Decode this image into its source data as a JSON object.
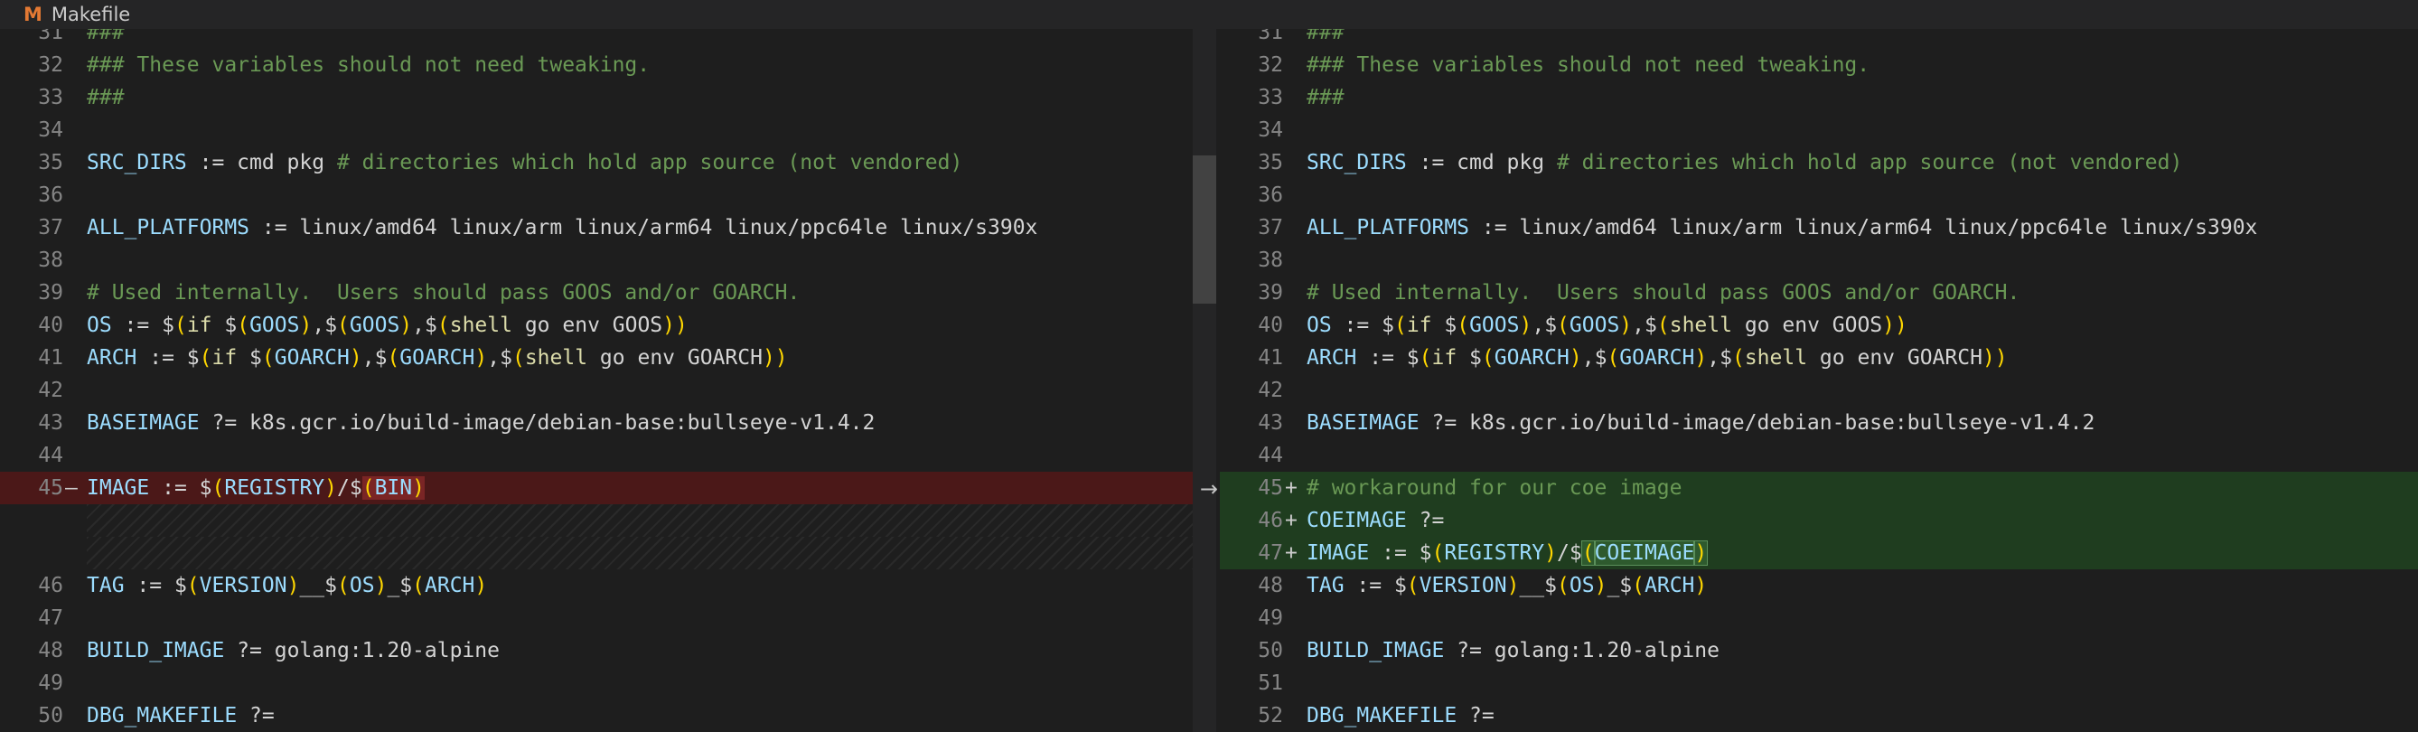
{
  "tab": {
    "icon": "makefile-icon",
    "icon_glyph": "M",
    "filename": "Makefile"
  },
  "colors": {
    "removed_bg": "#4b1818",
    "added_bg": "#1f3d1f",
    "comment": "#6a9955",
    "variable": "#9cdcfe",
    "function": "#dcdcaa",
    "bracket": "#ffd700"
  },
  "diff_arrow": "→",
  "left": [
    {
      "n": "31",
      "m": "",
      "type": "ctx",
      "t": [
        [
          "c-comment",
          "###"
        ]
      ]
    },
    {
      "n": "32",
      "m": "",
      "type": "ctx",
      "t": [
        [
          "c-comment",
          "### These variables should not need tweaking."
        ]
      ]
    },
    {
      "n": "33",
      "m": "",
      "type": "ctx",
      "t": [
        [
          "c-comment",
          "###"
        ]
      ]
    },
    {
      "n": "34",
      "m": "",
      "type": "ctx",
      "t": []
    },
    {
      "n": "35",
      "m": "",
      "type": "ctx",
      "t": [
        [
          "c-var",
          "SRC_DIRS"
        ],
        [
          "c-op",
          " := cmd pkg "
        ],
        [
          "c-comment",
          "# directories which hold app source (not vendored)"
        ]
      ]
    },
    {
      "n": "36",
      "m": "",
      "type": "ctx",
      "t": []
    },
    {
      "n": "37",
      "m": "",
      "type": "ctx",
      "t": [
        [
          "c-var",
          "ALL_PLATFORMS"
        ],
        [
          "c-op",
          " := linux/amd64 linux/arm linux/arm64 linux/ppc64le linux/s390x"
        ]
      ]
    },
    {
      "n": "38",
      "m": "",
      "type": "ctx",
      "t": []
    },
    {
      "n": "39",
      "m": "",
      "type": "ctx",
      "t": [
        [
          "c-comment",
          "# Used internally.  Users should pass GOOS and/or GOARCH."
        ]
      ]
    },
    {
      "n": "40",
      "m": "",
      "type": "ctx",
      "t": [
        [
          "c-var",
          "OS"
        ],
        [
          "c-op",
          " := "
        ],
        [
          "c-dollar",
          "$"
        ],
        [
          "c-paren",
          "("
        ],
        [
          "c-fn",
          "if "
        ],
        [
          "c-dollar",
          "$"
        ],
        [
          "c-paren",
          "("
        ],
        [
          "c-var",
          "GOOS"
        ],
        [
          "c-paren",
          ")"
        ],
        [
          "c-op",
          ","
        ],
        [
          "c-dollar",
          "$"
        ],
        [
          "c-paren",
          "("
        ],
        [
          "c-var",
          "GOOS"
        ],
        [
          "c-paren",
          ")"
        ],
        [
          "c-op",
          ","
        ],
        [
          "c-dollar",
          "$"
        ],
        [
          "c-paren",
          "("
        ],
        [
          "c-fn",
          "shell"
        ],
        [
          "c-text",
          " go env GOOS"
        ],
        [
          "c-paren",
          "))"
        ]
      ]
    },
    {
      "n": "41",
      "m": "",
      "type": "ctx",
      "t": [
        [
          "c-var",
          "ARCH"
        ],
        [
          "c-op",
          " := "
        ],
        [
          "c-dollar",
          "$"
        ],
        [
          "c-paren",
          "("
        ],
        [
          "c-fn",
          "if "
        ],
        [
          "c-dollar",
          "$"
        ],
        [
          "c-paren",
          "("
        ],
        [
          "c-var",
          "GOARCH"
        ],
        [
          "c-paren",
          ")"
        ],
        [
          "c-op",
          ","
        ],
        [
          "c-dollar",
          "$"
        ],
        [
          "c-paren",
          "("
        ],
        [
          "c-var",
          "GOARCH"
        ],
        [
          "c-paren",
          ")"
        ],
        [
          "c-op",
          ","
        ],
        [
          "c-dollar",
          "$"
        ],
        [
          "c-paren",
          "("
        ],
        [
          "c-fn",
          "shell"
        ],
        [
          "c-text",
          " go env GOARCH"
        ],
        [
          "c-paren",
          "))"
        ]
      ]
    },
    {
      "n": "42",
      "m": "",
      "type": "ctx",
      "t": []
    },
    {
      "n": "43",
      "m": "",
      "type": "ctx",
      "t": [
        [
          "c-var",
          "BASEIMAGE"
        ],
        [
          "c-op",
          " ?= k8s.gcr.io/build-image/debian-base:bullseye-v1.4.2"
        ]
      ]
    },
    {
      "n": "44",
      "m": "",
      "type": "ctx",
      "t": []
    },
    {
      "n": "45",
      "m": "—",
      "type": "removed",
      "t": [
        [
          "c-var",
          "IMAGE"
        ],
        [
          "c-op",
          " := "
        ],
        [
          "c-dollar",
          "$"
        ],
        [
          "c-paren",
          "("
        ],
        [
          "c-var",
          "REGISTRY"
        ],
        [
          "c-paren",
          ")"
        ],
        [
          "c-op",
          "/"
        ],
        [
          "c-dollar",
          "$"
        ],
        [
          "c-paren hl-removed",
          "("
        ],
        [
          "c-var hl-removed",
          "BIN"
        ],
        [
          "c-paren hl-removed",
          ")"
        ]
      ]
    },
    {
      "n": "",
      "m": "",
      "type": "filler",
      "t": []
    },
    {
      "n": "",
      "m": "",
      "type": "filler",
      "t": []
    },
    {
      "n": "46",
      "m": "",
      "type": "ctx",
      "t": [
        [
          "c-var",
          "TAG"
        ],
        [
          "c-op",
          " := "
        ],
        [
          "c-dollar",
          "$"
        ],
        [
          "c-paren",
          "("
        ],
        [
          "c-var",
          "VERSION"
        ],
        [
          "c-paren",
          ")"
        ],
        [
          "c-op",
          "__"
        ],
        [
          "c-dollar",
          "$"
        ],
        [
          "c-paren",
          "("
        ],
        [
          "c-var",
          "OS"
        ],
        [
          "c-paren",
          ")"
        ],
        [
          "c-op",
          "_"
        ],
        [
          "c-dollar",
          "$"
        ],
        [
          "c-paren",
          "("
        ],
        [
          "c-var",
          "ARCH"
        ],
        [
          "c-paren",
          ")"
        ]
      ]
    },
    {
      "n": "47",
      "m": "",
      "type": "ctx",
      "t": []
    },
    {
      "n": "48",
      "m": "",
      "type": "ctx",
      "t": [
        [
          "c-var",
          "BUILD_IMAGE"
        ],
        [
          "c-op",
          " ?= golang:1.20-alpine"
        ]
      ]
    },
    {
      "n": "49",
      "m": "",
      "type": "ctx",
      "t": []
    },
    {
      "n": "50",
      "m": "",
      "type": "ctx",
      "t": [
        [
          "c-var",
          "DBG_MAKEFILE"
        ],
        [
          "c-op",
          " ?="
        ]
      ]
    }
  ],
  "right": [
    {
      "n": "31",
      "m": "",
      "type": "ctx",
      "t": [
        [
          "c-comment",
          "###"
        ]
      ]
    },
    {
      "n": "32",
      "m": "",
      "type": "ctx",
      "t": [
        [
          "c-comment",
          "### These variables should not need tweaking."
        ]
      ]
    },
    {
      "n": "33",
      "m": "",
      "type": "ctx",
      "t": [
        [
          "c-comment",
          "###"
        ]
      ]
    },
    {
      "n": "34",
      "m": "",
      "type": "ctx",
      "t": []
    },
    {
      "n": "35",
      "m": "",
      "type": "ctx",
      "t": [
        [
          "c-var",
          "SRC_DIRS"
        ],
        [
          "c-op",
          " := cmd pkg "
        ],
        [
          "c-comment",
          "# directories which hold app source (not vendored)"
        ]
      ]
    },
    {
      "n": "36",
      "m": "",
      "type": "ctx",
      "t": []
    },
    {
      "n": "37",
      "m": "",
      "type": "ctx",
      "t": [
        [
          "c-var",
          "ALL_PLATFORMS"
        ],
        [
          "c-op",
          " := linux/amd64 linux/arm linux/arm64 linux/ppc64le linux/s390x"
        ]
      ]
    },
    {
      "n": "38",
      "m": "",
      "type": "ctx",
      "t": []
    },
    {
      "n": "39",
      "m": "",
      "type": "ctx",
      "t": [
        [
          "c-comment",
          "# Used internally.  Users should pass GOOS and/or GOARCH."
        ]
      ]
    },
    {
      "n": "40",
      "m": "",
      "type": "ctx",
      "t": [
        [
          "c-var",
          "OS"
        ],
        [
          "c-op",
          " := "
        ],
        [
          "c-dollar",
          "$"
        ],
        [
          "c-paren",
          "("
        ],
        [
          "c-fn",
          "if "
        ],
        [
          "c-dollar",
          "$"
        ],
        [
          "c-paren",
          "("
        ],
        [
          "c-var",
          "GOOS"
        ],
        [
          "c-paren",
          ")"
        ],
        [
          "c-op",
          ","
        ],
        [
          "c-dollar",
          "$"
        ],
        [
          "c-paren",
          "("
        ],
        [
          "c-var",
          "GOOS"
        ],
        [
          "c-paren",
          ")"
        ],
        [
          "c-op",
          ","
        ],
        [
          "c-dollar",
          "$"
        ],
        [
          "c-paren",
          "("
        ],
        [
          "c-fn",
          "shell"
        ],
        [
          "c-text",
          " go env GOOS"
        ],
        [
          "c-paren",
          "))"
        ]
      ]
    },
    {
      "n": "41",
      "m": "",
      "type": "ctx",
      "t": [
        [
          "c-var",
          "ARCH"
        ],
        [
          "c-op",
          " := "
        ],
        [
          "c-dollar",
          "$"
        ],
        [
          "c-paren",
          "("
        ],
        [
          "c-fn",
          "if "
        ],
        [
          "c-dollar",
          "$"
        ],
        [
          "c-paren",
          "("
        ],
        [
          "c-var",
          "GOARCH"
        ],
        [
          "c-paren",
          ")"
        ],
        [
          "c-op",
          ","
        ],
        [
          "c-dollar",
          "$"
        ],
        [
          "c-paren",
          "("
        ],
        [
          "c-var",
          "GOARCH"
        ],
        [
          "c-paren",
          ")"
        ],
        [
          "c-op",
          ","
        ],
        [
          "c-dollar",
          "$"
        ],
        [
          "c-paren",
          "("
        ],
        [
          "c-fn",
          "shell"
        ],
        [
          "c-text",
          " go env GOARCH"
        ],
        [
          "c-paren",
          "))"
        ]
      ]
    },
    {
      "n": "42",
      "m": "",
      "type": "ctx",
      "t": []
    },
    {
      "n": "43",
      "m": "",
      "type": "ctx",
      "t": [
        [
          "c-var",
          "BASEIMAGE"
        ],
        [
          "c-op",
          " ?= k8s.gcr.io/build-image/debian-base:bullseye-v1.4.2"
        ]
      ]
    },
    {
      "n": "44",
      "m": "",
      "type": "ctx",
      "t": []
    },
    {
      "n": "45",
      "m": "+",
      "type": "added",
      "t": [
        [
          "c-comment",
          "# workaround for our coe image"
        ]
      ]
    },
    {
      "n": "46",
      "m": "+",
      "type": "added",
      "t": [
        [
          "c-var",
          "COEIMAGE"
        ],
        [
          "c-op",
          " ?="
        ]
      ]
    },
    {
      "n": "47",
      "m": "+",
      "type": "added",
      "t": [
        [
          "c-var",
          "IMAGE"
        ],
        [
          "c-op",
          " := "
        ],
        [
          "c-dollar",
          "$"
        ],
        [
          "c-paren",
          "("
        ],
        [
          "c-var",
          "REGISTRY"
        ],
        [
          "c-paren",
          ")"
        ],
        [
          "c-op",
          "/"
        ],
        [
          "c-dollar",
          "$"
        ],
        [
          "c-paren hl-added",
          "("
        ],
        [
          "c-var hl-added",
          "COEIMAGE"
        ],
        [
          "c-paren hl-added",
          ")"
        ]
      ]
    },
    {
      "n": "48",
      "m": "",
      "type": "ctx",
      "t": [
        [
          "c-var",
          "TAG"
        ],
        [
          "c-op",
          " := "
        ],
        [
          "c-dollar",
          "$"
        ],
        [
          "c-paren",
          "("
        ],
        [
          "c-var",
          "VERSION"
        ],
        [
          "c-paren",
          ")"
        ],
        [
          "c-op",
          "__"
        ],
        [
          "c-dollar",
          "$"
        ],
        [
          "c-paren",
          "("
        ],
        [
          "c-var",
          "OS"
        ],
        [
          "c-paren",
          ")"
        ],
        [
          "c-op",
          "_"
        ],
        [
          "c-dollar",
          "$"
        ],
        [
          "c-paren",
          "("
        ],
        [
          "c-var",
          "ARCH"
        ],
        [
          "c-paren",
          ")"
        ]
      ]
    },
    {
      "n": "49",
      "m": "",
      "type": "ctx",
      "t": []
    },
    {
      "n": "50",
      "m": "",
      "type": "ctx",
      "t": [
        [
          "c-var",
          "BUILD_IMAGE"
        ],
        [
          "c-op",
          " ?= golang:1.20-alpine"
        ]
      ]
    },
    {
      "n": "51",
      "m": "",
      "type": "ctx",
      "t": []
    },
    {
      "n": "52",
      "m": "",
      "type": "ctx",
      "t": [
        [
          "c-var",
          "DBG_MAKEFILE"
        ],
        [
          "c-op",
          " ?="
        ]
      ]
    }
  ]
}
